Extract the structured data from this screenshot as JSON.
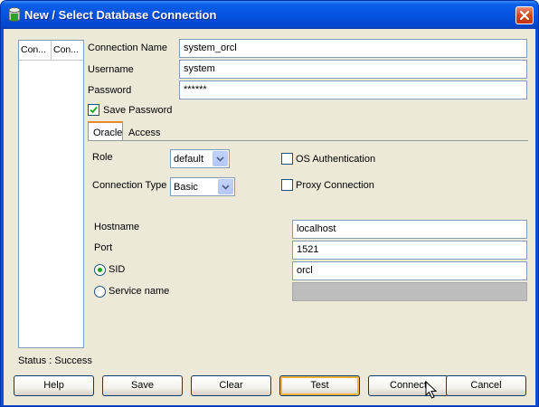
{
  "window": {
    "title": "New / Select Database Connection"
  },
  "connections_list": {
    "columns": [
      "Con...",
      "Con..."
    ]
  },
  "form": {
    "connection_name": {
      "label": "Connection Name",
      "value": "system_orcl"
    },
    "username": {
      "label": "Username",
      "value": "system"
    },
    "password": {
      "label": "Password",
      "value": "******"
    },
    "save_password": {
      "label": "Save Password",
      "checked": true
    }
  },
  "tabs": [
    {
      "label": "Oracle",
      "active": true
    },
    {
      "label": "Access",
      "active": false
    }
  ],
  "oracle": {
    "role": {
      "label": "Role",
      "value": "default"
    },
    "os_auth": {
      "label": "OS Authentication",
      "checked": false
    },
    "connection_type": {
      "label": "Connection Type",
      "value": "Basic"
    },
    "proxy": {
      "label": "Proxy Connection",
      "checked": false
    },
    "hostname": {
      "label": "Hostname",
      "value": "localhost"
    },
    "port": {
      "label": "Port",
      "value": "1521"
    },
    "sid": {
      "label": "SID",
      "value": "orcl",
      "selected": true
    },
    "service_name": {
      "label": "Service name",
      "value": "",
      "selected": false
    }
  },
  "status": "Status : Success",
  "buttons": {
    "help": "Help",
    "save": "Save",
    "clear": "Clear",
    "test": "Test",
    "connect": "Connect",
    "cancel": "Cancel"
  },
  "icons": {
    "title": "database-connection-icon",
    "close": "close-icon",
    "cursor": "mouse-pointer-icon"
  },
  "colors": {
    "titlebar": "#0553e1",
    "dialog_bg": "#ece9d8",
    "close_button": "#d5481f",
    "focus_ring": "#f8b33f"
  }
}
